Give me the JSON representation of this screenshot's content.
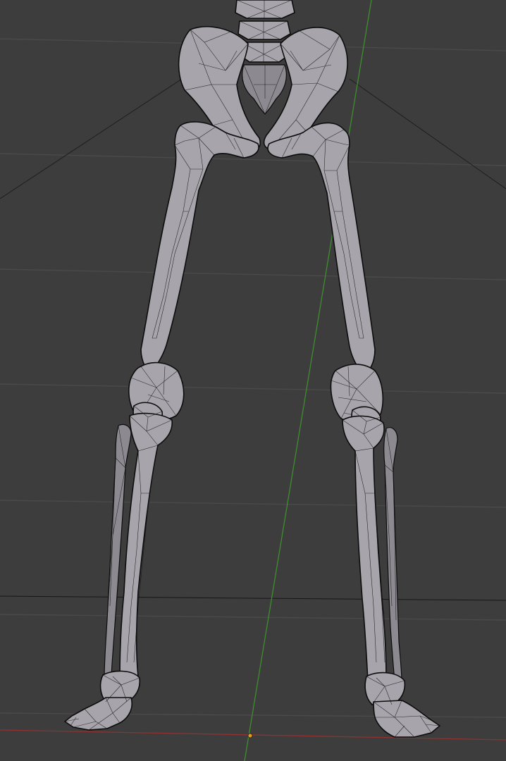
{
  "viewport": {
    "background": "#3d3d3d",
    "grid_color": "#4a4a4a",
    "y_axis_color": "#3f8d2f",
    "x_axis_color": "#8f3232",
    "mesh_fill": "#a7a5ab",
    "wire_color": "#151515",
    "origin_color": "#e29a2c",
    "display_mode": "solid-with-wireframe",
    "model": "skeleton-lower-body"
  }
}
